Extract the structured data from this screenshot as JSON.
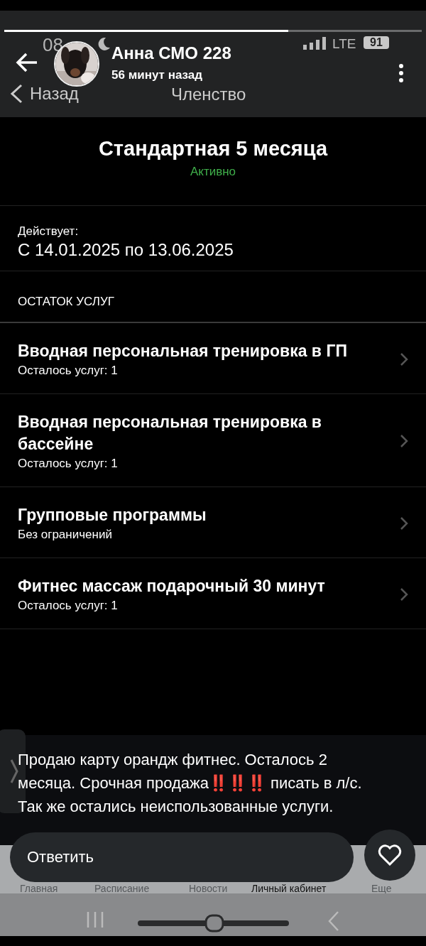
{
  "story": {
    "progress": {
      "level": 0.68
    },
    "author": "Анна СМО 228",
    "time_ago": "56 минут назад"
  },
  "status_bar": {
    "time": "08",
    "network": "LTE",
    "battery": "91"
  },
  "screen_header": {
    "back": "Назад",
    "title": "Членство"
  },
  "membership": {
    "title": "Стандартная 5 месяца",
    "status": "Активно",
    "valid_label": "Действует:",
    "valid_range": "С 14.01.2025 по 13.06.2025"
  },
  "services_heading": "ОСТАТОК УСЛУГ",
  "services": [
    {
      "name": "Вводная персональная тренировка в ГП",
      "detail": "Осталось услуг: 1"
    },
    {
      "name": "Вводная персональная тренировка в бассейне",
      "detail": "Осталось услуг: 1"
    },
    {
      "name": "Групповые программы",
      "detail": "Без ограничений"
    },
    {
      "name": "Фитнес массаж подарочный 30 минут",
      "detail": "Осталось услуг: 1"
    }
  ],
  "caption": "Продаю карту орандж фитнес. Осталось 2 месяца. Срочная продажа‼️‼️‼️ писать в л/с. Так же остались неиспользованные услуги.",
  "reply": {
    "placeholder": "Ответить"
  },
  "app_tabs": [
    {
      "label": "Главная",
      "selected": false
    },
    {
      "label": "Расписание",
      "selected": false
    },
    {
      "label": "Новости",
      "selected": false
    },
    {
      "label": "Личный кабинет",
      "selected": true
    },
    {
      "label": "Еще",
      "selected": false
    }
  ]
}
